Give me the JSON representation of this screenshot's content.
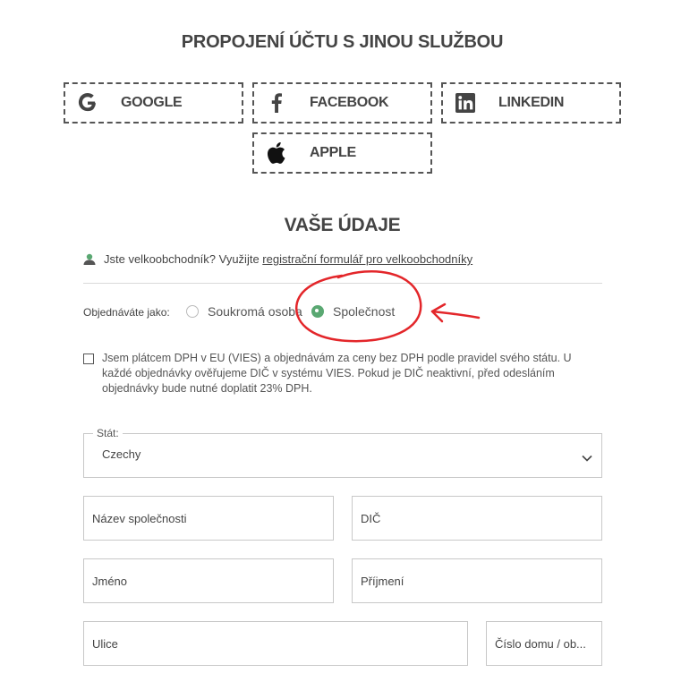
{
  "social_section": {
    "title": "PROPOJENÍ ÚČTU S JINOU SLUŽBOU",
    "buttons": [
      {
        "label": "GOOGLE",
        "icon": "google-icon"
      },
      {
        "label": "FACEBOOK",
        "icon": "facebook-icon"
      },
      {
        "label": "LINKEDIN",
        "icon": "linkedin-icon"
      },
      {
        "label": "APPLE",
        "icon": "apple-icon"
      }
    ]
  },
  "details": {
    "title": "VAŠE ÚDAJE",
    "wholesale_text": "Jste velkoobchodník? Využijte",
    "wholesale_link": "registrační formulář pro velkoobchodníky",
    "order_as_label": "Objednáváte jako:",
    "order_options": [
      {
        "label": "Soukromá osoba",
        "selected": false
      },
      {
        "label": "Společnost",
        "selected": true
      }
    ],
    "vat_checkbox_text": "Jsem plátcem DPH v EU (VIES) a objednávám za ceny bez DPH podle pravidel svého státu. U každé objednávky ověřujeme DIČ v systému VIES. Pokud je DIČ neaktivní, před odesláním objednávky bude nutné doplatit 23% DPH.",
    "vat_checked": false
  },
  "form": {
    "country_legend": "Stát:",
    "country_value": "Czechy",
    "company_name_placeholder": "Název společnosti",
    "vat_id_placeholder": "DIČ",
    "first_name_placeholder": "Jméno",
    "last_name_placeholder": "Příjmení",
    "street_placeholder": "Ulice",
    "house_number_placeholder": "Číslo domu / ob..."
  },
  "colors": {
    "accent_green": "#5aa872",
    "annotation_red": "#e3262a",
    "text": "#444444"
  }
}
